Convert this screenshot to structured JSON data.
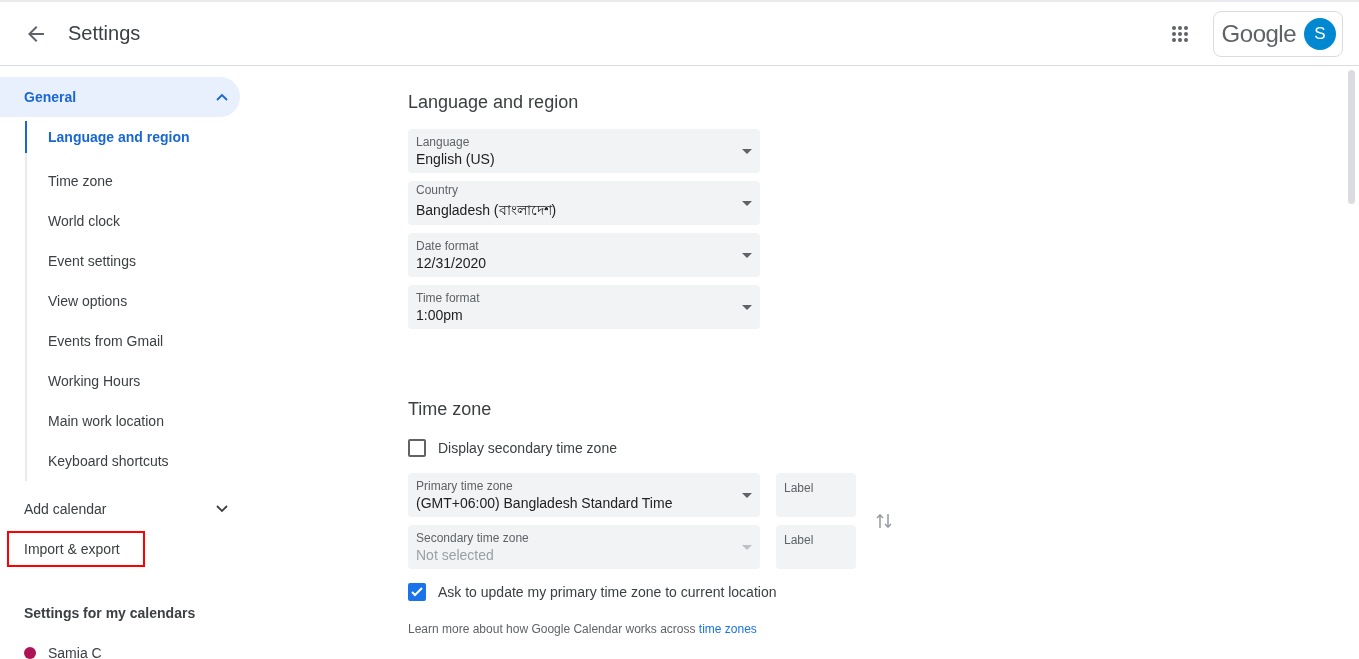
{
  "header": {
    "title": "Settings",
    "logo": "Google",
    "avatar_initial": "S"
  },
  "sidebar": {
    "items": [
      {
        "kind": "group",
        "label": "General",
        "selected": true,
        "expanded": true,
        "highlighted": false,
        "children": [
          {
            "label": "Language and region",
            "selected": true
          },
          {
            "label": "Time zone",
            "selected": false
          },
          {
            "label": "World clock",
            "selected": false
          },
          {
            "label": "Event settings",
            "selected": false
          },
          {
            "label": "View options",
            "selected": false
          },
          {
            "label": "Events from Gmail",
            "selected": false
          },
          {
            "label": "Working Hours",
            "selected": false
          },
          {
            "label": "Main work location",
            "selected": false
          },
          {
            "label": "Keyboard shortcuts",
            "selected": false
          }
        ]
      },
      {
        "kind": "group",
        "label": "Add calendar",
        "selected": false,
        "expanded": false,
        "highlighted": false
      },
      {
        "kind": "link",
        "label": "Import & export",
        "selected": false,
        "highlighted": true
      }
    ],
    "calendars_heading": "Settings for my calendars",
    "calendars": [
      {
        "name": "Samia C",
        "color": "#ad1457"
      }
    ]
  },
  "language_region": {
    "title": "Language and region",
    "fields": [
      {
        "label": "Language",
        "value": "English (US)"
      },
      {
        "label": "Country",
        "value": "Bangladesh (বাংলাদেশ)"
      },
      {
        "label": "Date format",
        "value": "12/31/2020"
      },
      {
        "label": "Time format",
        "value": "1:00pm"
      }
    ]
  },
  "time_zone": {
    "title": "Time zone",
    "display_secondary": {
      "label": "Display secondary time zone",
      "checked": false
    },
    "zones": [
      {
        "label": "Primary time zone",
        "value": "(GMT+06:00) Bangladesh Standard Time",
        "disabled": false,
        "side_label": "Label"
      },
      {
        "label": "Secondary time zone",
        "value": "Not selected",
        "disabled": true,
        "side_label": "Label"
      }
    ],
    "ask_update": {
      "label": "Ask to update my primary time zone to current location",
      "checked": true
    },
    "note": {
      "text": "Learn more about how Google Calendar works across",
      "link": "time zones"
    }
  }
}
